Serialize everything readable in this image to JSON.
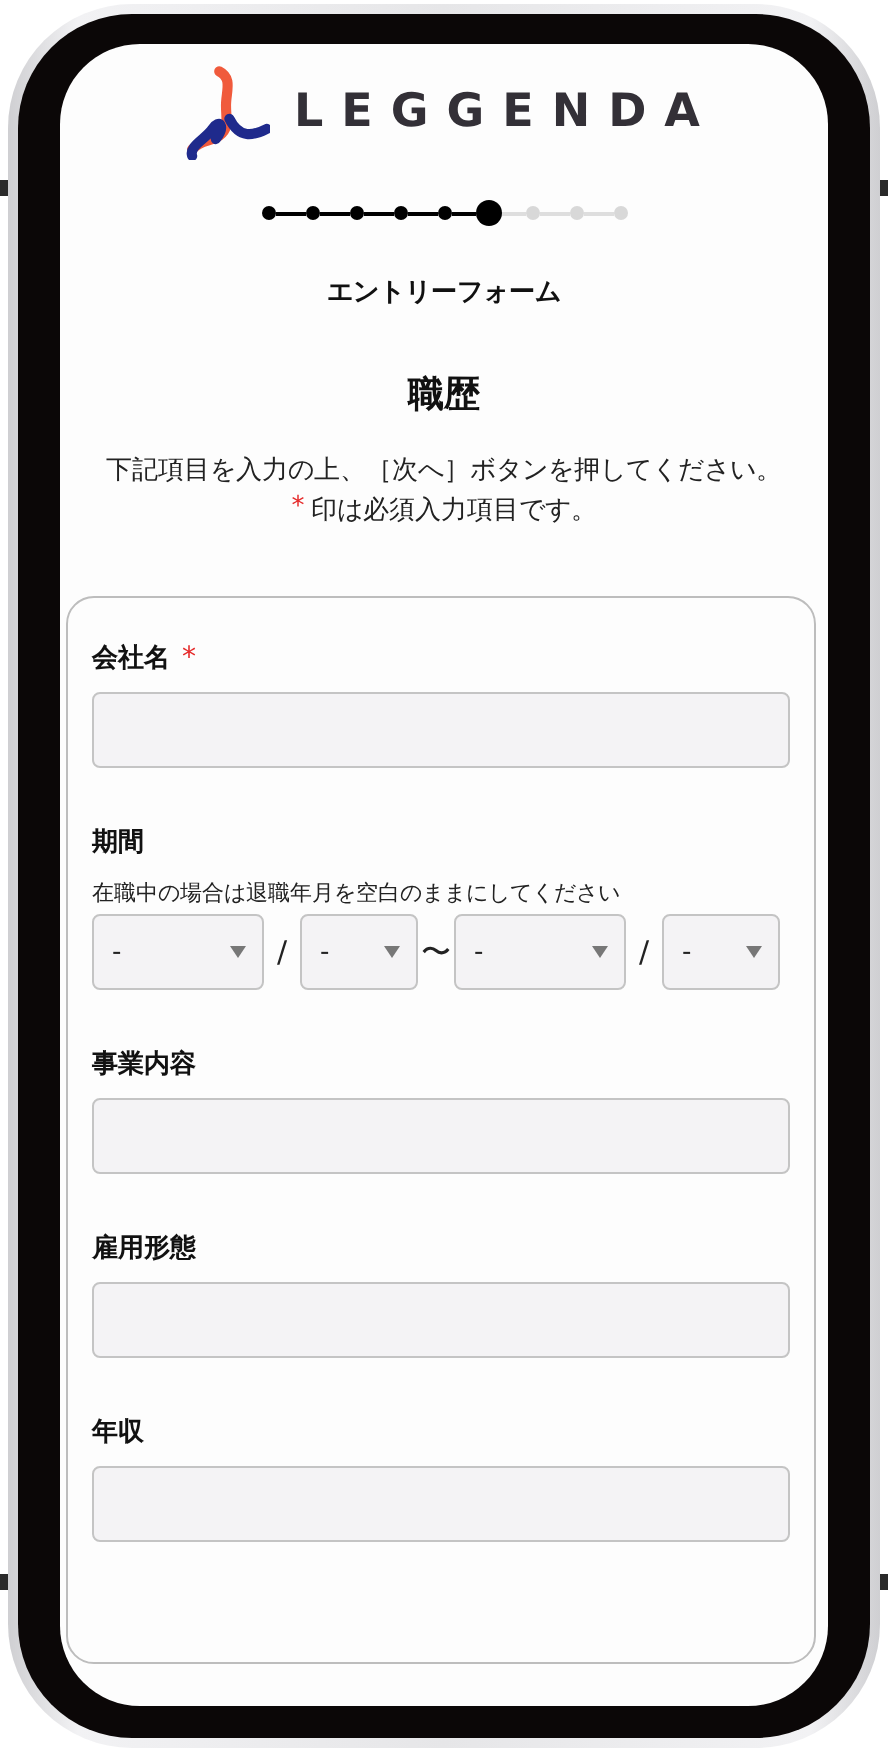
{
  "logo": {
    "text": "LEGGENDA"
  },
  "steps": [
    {
      "kind": "done"
    },
    {
      "kind": "done"
    },
    {
      "kind": "done"
    },
    {
      "kind": "done"
    },
    {
      "kind": "done"
    },
    {
      "kind": "current"
    },
    {
      "kind": "todo"
    },
    {
      "kind": "todo"
    },
    {
      "kind": "todo"
    }
  ],
  "form_title": "エントリーフォーム",
  "section_title": "職歴",
  "instruction": "下記項目を入力の上、［次へ］ボタンを押してください。",
  "required_note": {
    "mark": "*",
    "text": "印は必須入力項目です。"
  },
  "fields": [
    {
      "kind": "text",
      "label": "会社名",
      "required_mark": "*"
    },
    {
      "kind": "date_range",
      "label": "期間",
      "hint": "在職中の場合は退職年月を空白のままにしてください",
      "parts": [
        {
          "kind": "year_select",
          "value": "-"
        },
        {
          "kind": "separator",
          "text": "/"
        },
        {
          "kind": "month_select",
          "value": "-"
        },
        {
          "kind": "separator",
          "text": "〜"
        },
        {
          "kind": "year_select",
          "value": "-"
        },
        {
          "kind": "separator",
          "text": "/"
        },
        {
          "kind": "month_select",
          "value": "-"
        }
      ]
    },
    {
      "kind": "text",
      "label": "事業内容"
    },
    {
      "kind": "text",
      "label": "雇用形態"
    },
    {
      "kind": "text",
      "label": "年収"
    }
  ]
}
